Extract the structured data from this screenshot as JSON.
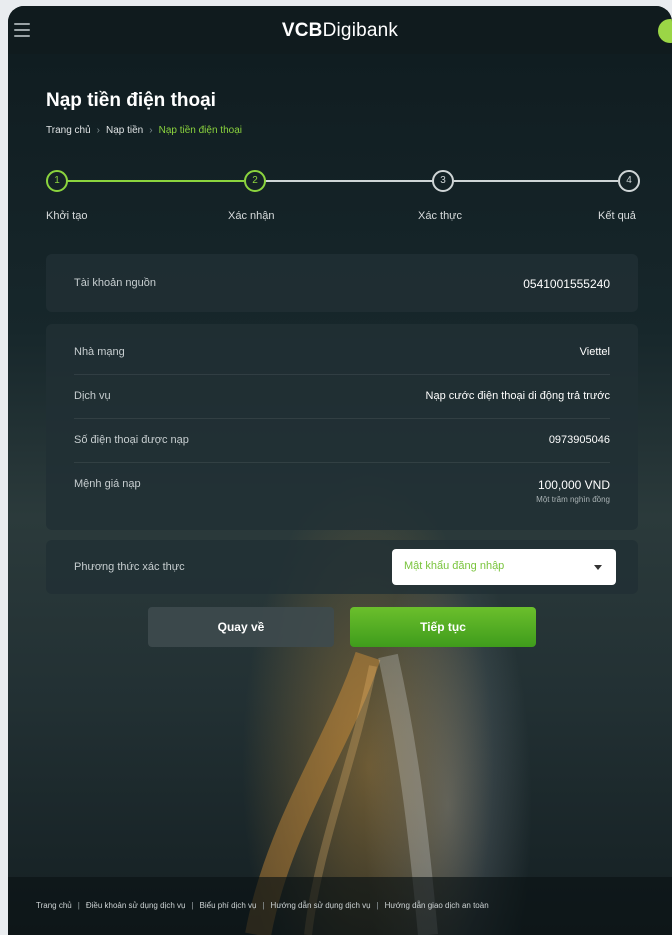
{
  "app": {
    "logo_bold": "VCB",
    "logo_light": "Digibank"
  },
  "page": {
    "title": "Nạp tiền điện thoại"
  },
  "breadcrumb": {
    "items": [
      "Trang chủ",
      "Nạp tiền",
      "Nạp tiền điện thoại"
    ]
  },
  "stepper": {
    "steps": [
      {
        "number": "1",
        "label": "Khởi tạo"
      },
      {
        "number": "2",
        "label": "Xác nhận"
      },
      {
        "number": "3",
        "label": "Xác thực"
      },
      {
        "number": "4",
        "label": "Kết quả"
      }
    ]
  },
  "source_account": {
    "label": "Tài khoản nguồn",
    "value": "0541001555240"
  },
  "details": {
    "carrier_label": "Nhà mạng",
    "carrier_value": "Viettel",
    "service_label": "Dịch vụ",
    "service_value": "Nạp cước điện thoại di động trả trước",
    "phone_label": "Số điện thoại được nạp",
    "phone_value": "0973905046",
    "amount_label": "Mệnh giá nạp",
    "amount_value": "100,000 VND",
    "amount_words": "Một trăm nghìn đồng"
  },
  "auth": {
    "label": "Phương thức xác thực",
    "selected": "Mật khẩu đăng nhập"
  },
  "buttons": {
    "back": "Quay về",
    "next": "Tiếp tục"
  },
  "footer": {
    "links": [
      "Trang chủ",
      "Điều khoản sử dụng dịch vụ",
      "Biểu phí dịch vụ",
      "Hướng dẫn sử dụng dịch vụ",
      "Hướng dẫn giao dịch an toàn"
    ]
  },
  "colors": {
    "accent": "#8bd43e",
    "button_primary": "#4fa91f",
    "background": "#17272b"
  }
}
